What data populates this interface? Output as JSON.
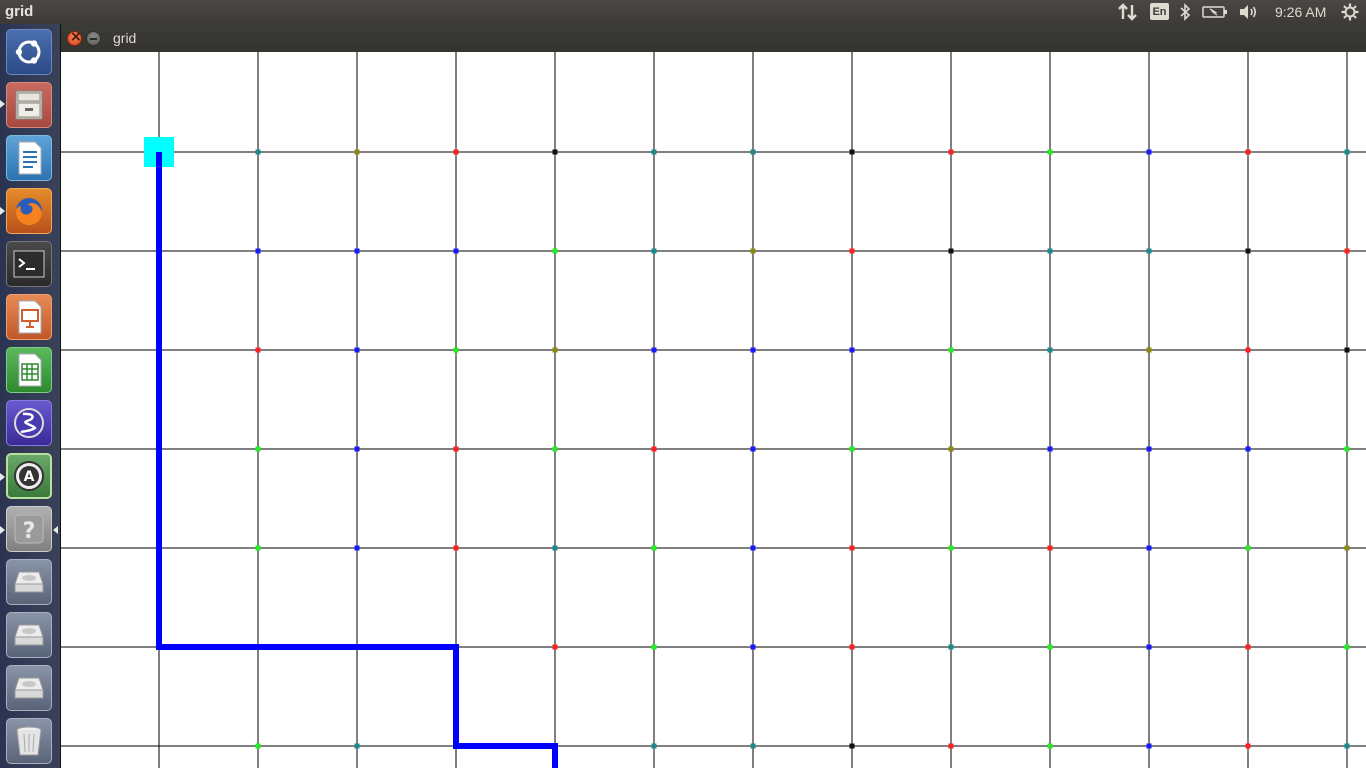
{
  "topbar": {
    "app_name": "grid",
    "language": "En",
    "clock": "9:26 AM",
    "icons": [
      "network-arrows-icon",
      "keyboard-language-icon",
      "bluetooth-icon",
      "battery-icon",
      "volume-icon",
      "settings-gear-icon"
    ]
  },
  "window": {
    "title": "grid",
    "buttons": [
      "close",
      "minimize"
    ],
    "colors": {
      "close": "#e0501f",
      "minimize": "#6b6a66"
    }
  },
  "launcher": {
    "items": [
      "ubuntu-dash",
      "files",
      "libreoffice-writer",
      "firefox",
      "terminal",
      "libreoffice-impress",
      "libreoffice-calc",
      "emacs",
      "software-updater",
      "help",
      "drive-1",
      "drive-2",
      "drive-3",
      "trash"
    ]
  },
  "grid": {
    "columns": 13,
    "rows": 7,
    "node_colors": {
      "T": "#1b8a8a",
      "O": "#8a8a10",
      "R": "#ff2020",
      "K": "#111111",
      "G": "#22ee22",
      "B": "#1a1aff"
    },
    "node_rows": [
      "TORKTTKRGBRT",
      "BBBGTORKTTKR",
      "RBGOBBBGTORK",
      "GBRGRBGOBBBG",
      "GBRTGBRGRBGO",
      "BBBRGBRTGBRG",
      "GTOBTTKRGBRT"
    ],
    "start_marker_color": "#00ffff",
    "path_color": "#0000ff",
    "path": [
      [
        1,
        1
      ],
      [
        1,
        6
      ],
      [
        4,
        6
      ],
      [
        4,
        7
      ],
      [
        5,
        7
      ],
      [
        5,
        7.3
      ]
    ]
  }
}
